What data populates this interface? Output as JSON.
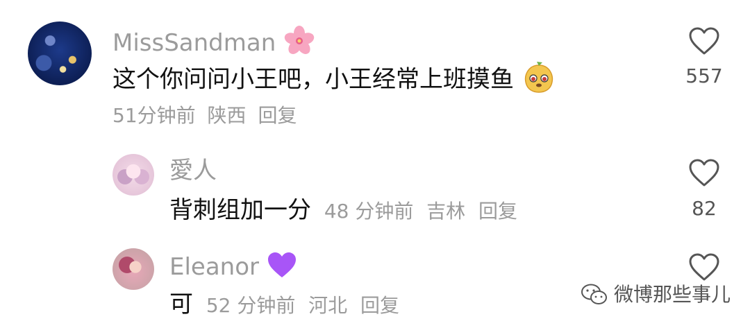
{
  "comments": [
    {
      "username": "MissSandman",
      "username_emoji": "cherry-blossom-emoji",
      "text": "这个你问问小王吧，小王经常上班摸鱼",
      "text_emoji": "doge-mango-emoji",
      "time": "51分钟前",
      "location": "陕西",
      "reply_label": "回复",
      "likes": "557"
    },
    {
      "username": "愛人",
      "text": "背刺组加一分",
      "time": "48 分钟前",
      "location": "吉林",
      "reply_label": "回复",
      "likes": "82"
    },
    {
      "username": "Eleanor",
      "username_emoji": "purple-heart-emoji",
      "text": "可",
      "time": "52 分钟前",
      "location": "河北",
      "reply_label": "回复"
    }
  ],
  "watermark": {
    "text": "微博那些事儿",
    "icon": "wechat-icon"
  },
  "colors": {
    "meta_gray": "#9b9b9b",
    "text_black": "#111111"
  }
}
